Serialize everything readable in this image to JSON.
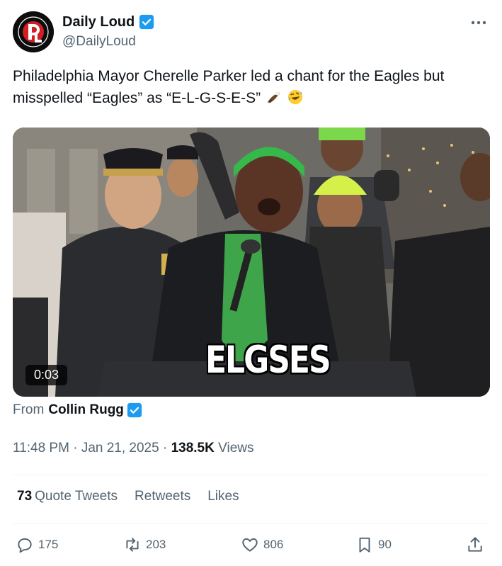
{
  "author": {
    "display_name": "Daily Loud",
    "handle": "@DailyLoud",
    "avatar_icon": "daily-loud-logo",
    "verified_icon": "verified-badge-icon"
  },
  "tweet": {
    "text": "Philadelphia Mayor Cherelle Parker led a chant for the Eagles but misspelled “Eagles” as “E-L-G-S-E-S”",
    "emojis": [
      "eagle-emoji",
      "rolling-laughing-emoji"
    ]
  },
  "media": {
    "duration": "0:03",
    "caption": "ELGSES"
  },
  "from": {
    "label": "From",
    "name": "Collin Rugg"
  },
  "meta": {
    "time": "11:48 PM",
    "separator1": "·",
    "date": "Jan 21, 2025",
    "separator2": "·",
    "views_count": "138.5K",
    "views_label": "Views"
  },
  "stats": {
    "quote_count": "73",
    "quote_label": "Quote Tweets",
    "retweets_label": "Retweets",
    "likes_label": "Likes"
  },
  "actions": {
    "replies": "175",
    "retweets": "203",
    "likes": "806",
    "bookmarks": "90"
  },
  "colors": {
    "verified": "#1d9bf0",
    "secondary_text": "#536471",
    "primary_text": "#0f1419"
  }
}
